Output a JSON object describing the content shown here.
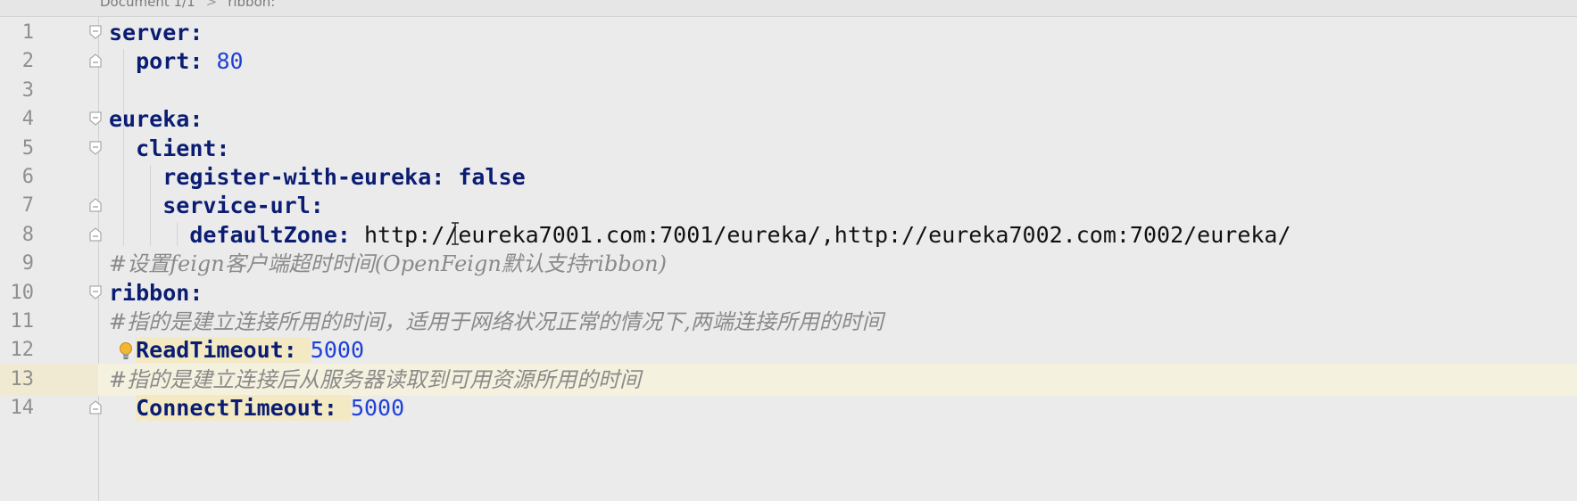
{
  "breadcrumb": {
    "document": "Document 1/1",
    "separator": ">",
    "node": "ribbon:"
  },
  "lines": [
    {
      "n": "1",
      "key": "server",
      "sep": ":"
    },
    {
      "n": "2",
      "indent": "  ",
      "key": "port",
      "sep": ": ",
      "num": "80"
    },
    {
      "n": "3"
    },
    {
      "n": "4",
      "key": "eureka",
      "sep": ":"
    },
    {
      "n": "5",
      "indent": "  ",
      "key": "client",
      "sep": ":"
    },
    {
      "n": "6",
      "indent": "    ",
      "key": "register-with-eureka",
      "sep": ": ",
      "bool": "false"
    },
    {
      "n": "7",
      "indent": "    ",
      "key": "service-url",
      "sep": ":"
    },
    {
      "n": "8",
      "indent": "      ",
      "key": "defaultZone",
      "sep": ": ",
      "str": "http://eureka7001.com:7001/eureka/,http://eureka7002.com:7002/eureka/"
    },
    {
      "n": "9",
      "comment": "#设置feign客户端超时时间(OpenFeign默认支持ribbon)"
    },
    {
      "n": "10",
      "key": "ribbon",
      "sep": ":"
    },
    {
      "n": "11",
      "comment": "#指的是建立连接所用的时间，适用于网络状况正常的情况下,两端连接所用的时间"
    },
    {
      "n": "12",
      "indent": "  ",
      "key": "ReadTimeout",
      "sep": ": ",
      "num": "5000"
    },
    {
      "n": "13",
      "comment": "#指的是建立连接后从服务器读取到可用资源所用的时间"
    },
    {
      "n": "14",
      "indent": "  ",
      "key": "ConnectTimeout",
      "sep": ": ",
      "num": "5000"
    }
  ],
  "colors": {
    "key": "#0b1d73",
    "number": "#1f41d6",
    "comment": "#8a8a8a",
    "current_line": "#f5f1df"
  },
  "icons": {
    "fold_open": "fold-open-icon",
    "fold_end": "fold-end-icon",
    "intention_bulb": "lightbulb-icon",
    "text_cursor": "i-beam-cursor-icon"
  }
}
